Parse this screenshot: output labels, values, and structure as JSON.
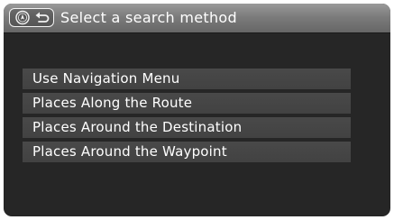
{
  "header": {
    "title": "Select a search method",
    "nav_icon": "compass-icon",
    "back_icon": "back-arrow-icon"
  },
  "menu": {
    "items": [
      {
        "label": "Use Navigation Menu"
      },
      {
        "label": "Places Along the Route"
      },
      {
        "label": "Places Around the Destination"
      },
      {
        "label": "Places Around the Waypoint"
      }
    ]
  },
  "colors": {
    "screen_background": "#262626",
    "header_gradient_top": "#9a9a9a",
    "header_gradient_bottom": "#666666",
    "menu_item_background": "#464646",
    "text": "#ffffff"
  }
}
